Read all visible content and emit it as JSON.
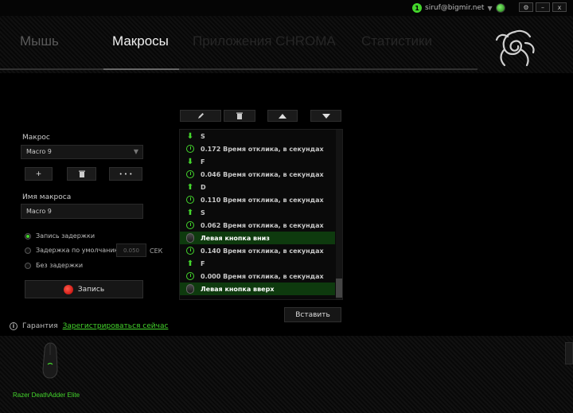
{
  "header": {
    "notification_count": "1",
    "user_email": "siruf@bigmir.net",
    "dropdown_icon": "caret-down-icon",
    "window_controls": [
      "⚙",
      "–",
      "x"
    ]
  },
  "nav": {
    "tabs": [
      {
        "label": "Мышь",
        "state": "inactive"
      },
      {
        "label": "Макросы",
        "state": "active"
      },
      {
        "label": "Приложения CHROMA",
        "state": "disabled"
      },
      {
        "label": "Статистики",
        "state": "disabled"
      }
    ]
  },
  "left": {
    "macro_label": "Макрос",
    "macro_selected": "Macro 9",
    "add_label": "+",
    "delete_icon": "trash-icon",
    "more_label": "• • •",
    "name_label": "Имя макроса",
    "name_value": "Macro 9",
    "radios": [
      {
        "label": "Запись задержки",
        "checked": true
      },
      {
        "label": "Задержка по умолчанию",
        "checked": false
      },
      {
        "label": "Без задержки",
        "checked": false
      }
    ],
    "default_delay": "0.050",
    "delay_unit": "СЕК",
    "record_label": "Запись"
  },
  "toolbar": {
    "icons": [
      "pencil-icon",
      "trash-icon",
      "arrow-up-icon",
      "arrow-down-icon"
    ]
  },
  "macro_steps": [
    {
      "type": "key-down",
      "text": "S"
    },
    {
      "type": "delay",
      "text": "0.172 Время отклика, в секундах"
    },
    {
      "type": "key-down",
      "text": "F"
    },
    {
      "type": "delay",
      "text": "0.046 Время отклика, в секундах"
    },
    {
      "type": "key-up",
      "text": "D"
    },
    {
      "type": "delay",
      "text": "0.110 Время отклика, в секундах"
    },
    {
      "type": "key-up",
      "text": "S"
    },
    {
      "type": "delay",
      "text": "0.062 Время отклика, в секундах"
    },
    {
      "type": "mouse",
      "text": "Левая кнопка вниз"
    },
    {
      "type": "delay",
      "text": "0.140 Время отклика, в секундах"
    },
    {
      "type": "key-up",
      "text": "F"
    },
    {
      "type": "delay",
      "text": "0.000 Время отклика, в секундах"
    },
    {
      "type": "mouse",
      "text": "Левая кнопка вверх"
    }
  ],
  "insert_label": "Вставить",
  "footer": {
    "warranty_label": "Гарантия",
    "register_link": "Зарегистрироваться сейчас",
    "device_name": "Razer DeathAdder Elite"
  },
  "colors": {
    "accent": "#44d62c",
    "selected_row": "#0e3a0e",
    "record": "#e0281e"
  }
}
